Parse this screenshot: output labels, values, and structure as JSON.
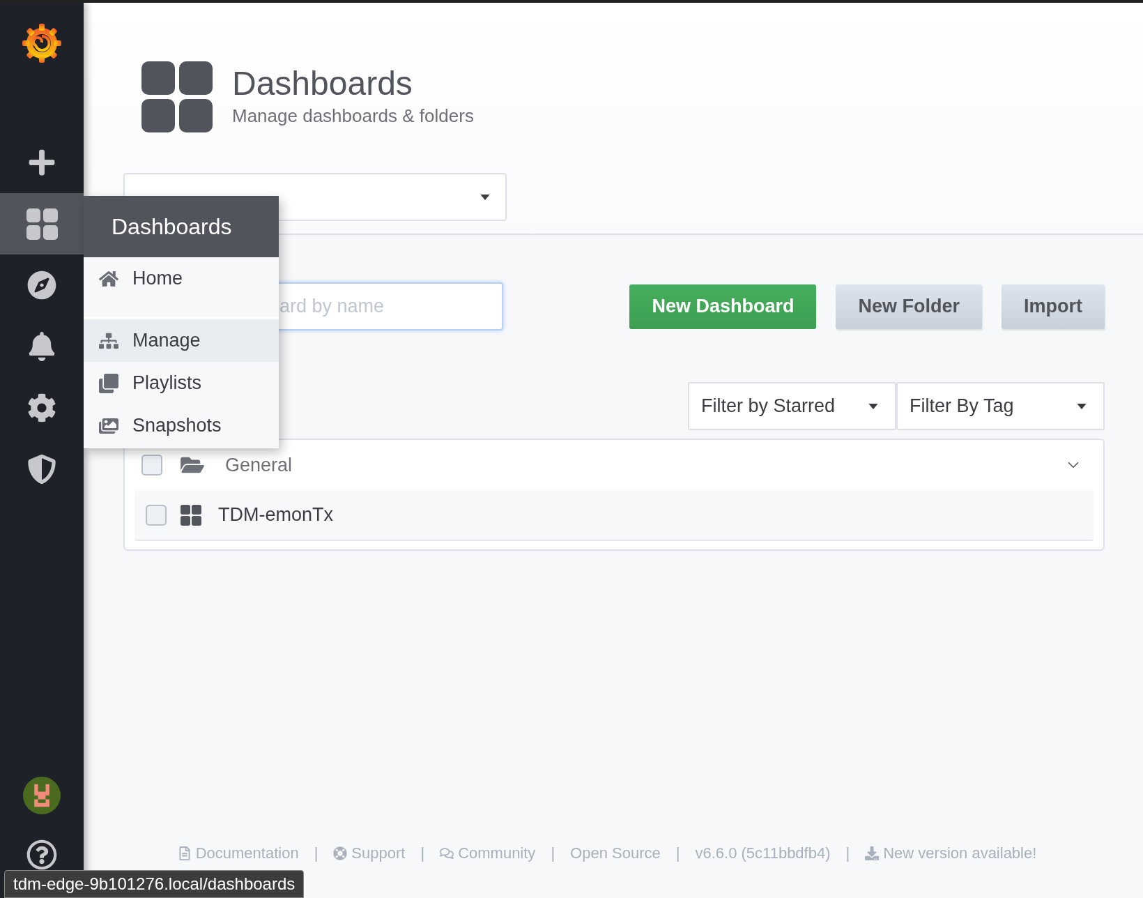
{
  "sidebar": {
    "items": [
      {
        "kind": "create",
        "selected": false
      },
      {
        "kind": "dashboards",
        "selected": true
      },
      {
        "kind": "explore",
        "selected": false
      },
      {
        "kind": "alerting",
        "selected": false
      },
      {
        "kind": "configuration",
        "selected": false
      },
      {
        "kind": "admin",
        "selected": false
      }
    ]
  },
  "flyout": {
    "title": "Dashboards",
    "items": [
      {
        "label": "Home",
        "kind": "home",
        "selected": false,
        "divider": true
      },
      {
        "label": "Manage",
        "kind": "manage",
        "selected": true,
        "divider": false
      },
      {
        "label": "Playlists",
        "kind": "playlists",
        "selected": false,
        "divider": false
      },
      {
        "label": "Snapshots",
        "kind": "snapshots",
        "selected": false,
        "divider": false
      }
    ]
  },
  "page_header": {
    "title": "Dashboards",
    "subtitle": "Manage dashboards & folders"
  },
  "search": {
    "placeholder": "ard by name"
  },
  "buttons": [
    {
      "label": "New Dashboard",
      "kind": "primary"
    },
    {
      "label": "New Folder",
      "kind": "secondary"
    },
    {
      "label": "Import",
      "kind": "secondary"
    }
  ],
  "filters": [
    {
      "label": "Filter by Starred"
    },
    {
      "label": "Filter By Tag"
    }
  ],
  "folders": [
    {
      "name": "General",
      "expanded": true,
      "checked": false,
      "dashboards": [
        {
          "name": "TDM-emonTx",
          "checked": false
        }
      ]
    }
  ],
  "footer": {
    "separator": "|",
    "links": [
      {
        "label": "Documentation",
        "kind": "documentation"
      },
      {
        "label": "Support",
        "kind": "support"
      },
      {
        "label": "Community",
        "kind": "community"
      },
      {
        "label": "Open Source",
        "kind": "text"
      },
      {
        "label": "v6.6.0 (5c11bbdfb4)",
        "kind": "text"
      },
      {
        "label": "New version available!",
        "kind": "download"
      }
    ]
  },
  "status_url": "tdm-edge-9b101276.local/dashboards"
}
